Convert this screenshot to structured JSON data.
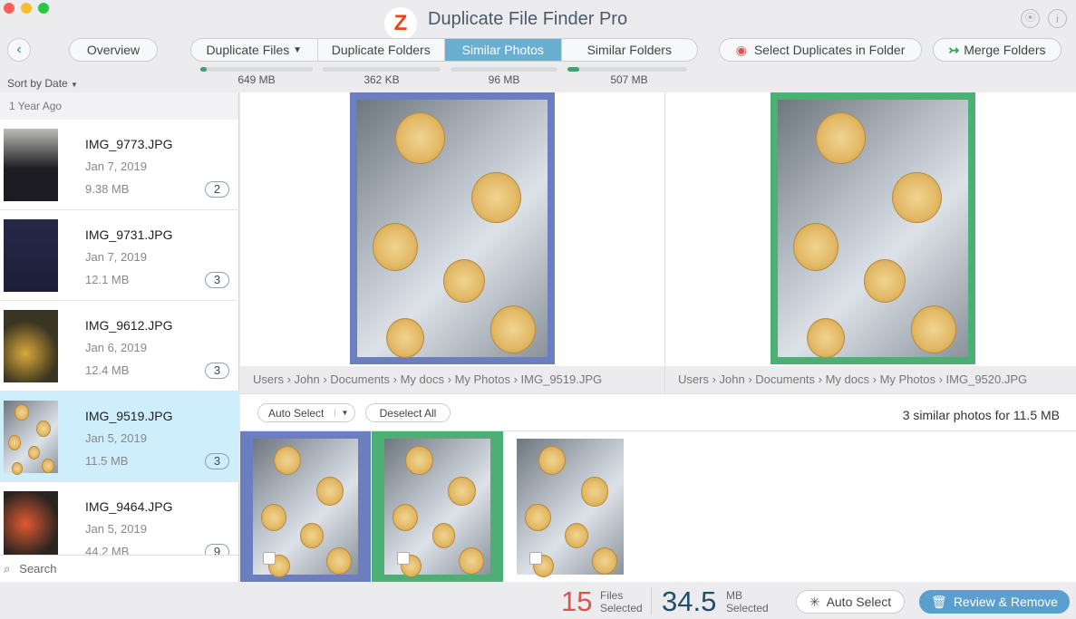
{
  "window": {
    "title": "Duplicate File Finder Pro",
    "logo_letter": "Z"
  },
  "toolbar": {
    "overview": "Overview",
    "tabs": [
      {
        "label": "Duplicate Files",
        "size": "649 MB",
        "progress": 0.06
      },
      {
        "label": "Duplicate Folders",
        "size": "362 KB",
        "progress": 0
      },
      {
        "label": "Similar Photos",
        "size": "96 MB",
        "progress": 0,
        "active": true
      },
      {
        "label": "Similar Folders",
        "size": "507 MB",
        "progress": 0.1
      }
    ],
    "select_dupes": "Select Duplicates in Folder",
    "merge": "Merge Folders"
  },
  "sidebar": {
    "sort": "Sort by Date",
    "group": "1 Year Ago",
    "items": [
      {
        "name": "IMG_9773.JPG",
        "date": "Jan 7, 2019",
        "size": "9.38 MB",
        "count": "2"
      },
      {
        "name": "IMG_9731.JPG",
        "date": "Jan 7, 2019",
        "size": "12.1 MB",
        "count": "3"
      },
      {
        "name": "IMG_9612.JPG",
        "date": "Jan 6, 2019",
        "size": "12.4 MB",
        "count": "3"
      },
      {
        "name": "IMG_9519.JPG",
        "date": "Jan 5, 2019",
        "size": "11.5 MB",
        "count": "3",
        "selected": true
      },
      {
        "name": "IMG_9464.JPG",
        "date": "Jan 5, 2019",
        "size": "44.2 MB",
        "count": "9"
      }
    ],
    "search": "Search"
  },
  "preview": {
    "left_path": [
      "Users",
      "John",
      "Documents",
      "My docs",
      "My Photos",
      "IMG_9519.JPG"
    ],
    "right_path": [
      "Users",
      "John",
      "Documents",
      "My docs",
      "My Photos",
      "IMG_9520.JPG"
    ]
  },
  "actions": {
    "auto_select": "Auto Select",
    "deselect_all": "Deselect All",
    "summary": "3 similar photos for 11.5 MB"
  },
  "footer": {
    "files_count": "15",
    "files_label1": "Files",
    "files_label2": "Selected",
    "mb_count": "34.5",
    "mb_label1": "MB",
    "mb_label2": "Selected",
    "auto_select": "Auto Select",
    "review": "Review & Remove"
  },
  "colors": {
    "accent": "#6aaed0",
    "selected_blue": "#6b7fc0",
    "selected_green": "#4caf73",
    "files_count": "#d9534f",
    "mb_count": "#1f4e6b"
  }
}
